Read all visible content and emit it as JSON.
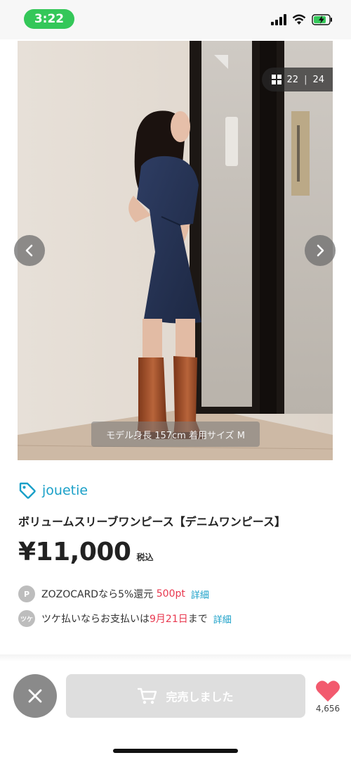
{
  "status_bar": {
    "time": "3:22"
  },
  "gallery": {
    "counter_current": "22",
    "counter_separator": "|",
    "counter_total": "24",
    "model_caption": "モデル身長 157cm 着用サイズ M"
  },
  "product": {
    "brand": "jouetie",
    "title": "ボリュームスリーブワンピース【デニムワンピース】",
    "price": "¥11,000",
    "tax_label": "税込"
  },
  "promos": {
    "zozocard_icon_text": "P",
    "zozocard_text": "ZOZOCARDなら5%還元 ",
    "zozocard_points": "500pt",
    "zozocard_link": "詳細",
    "tsuke_icon_text": "ツケ",
    "tsuke_text_before": "ツケ払いならお支払いは",
    "tsuke_date": "9月21日",
    "tsuke_text_after": "まで",
    "tsuke_link": "詳細"
  },
  "actions": {
    "sold_out_label": "完売しました",
    "favorite_count": "4,656"
  },
  "colors": {
    "accent": "#1aa0c8",
    "highlight": "#e8374e",
    "favorite": "#f25a6e",
    "time_pill": "#34c759"
  },
  "icons": {
    "brand": "tag-icon",
    "cart": "cart-icon",
    "close": "close-icon",
    "favorite": "heart-icon",
    "gallery": "grid-icon"
  }
}
